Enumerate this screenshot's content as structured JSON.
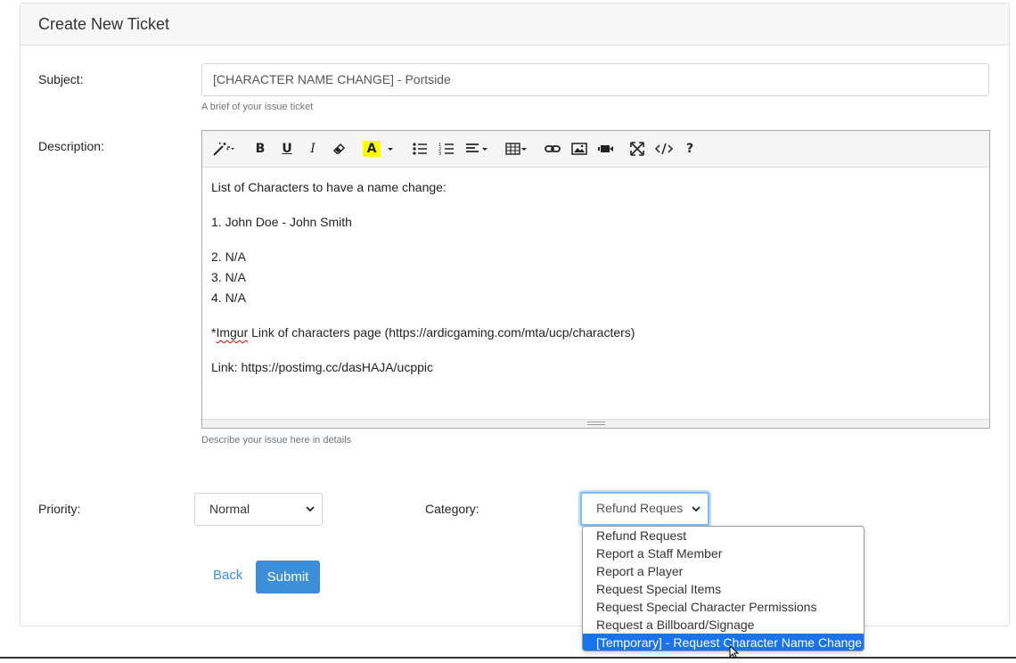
{
  "card": {
    "title": "Create New Ticket"
  },
  "subject": {
    "label": "Subject:",
    "value": "[CHARACTER NAME CHANGE] - Portside",
    "help": "A brief of your issue ticket"
  },
  "description": {
    "label": "Description:",
    "help": "Describe your issue here in details",
    "toolbar_icons": [
      "magic-icon",
      "bold-icon",
      "underline-icon",
      "italic-icon",
      "eraser-icon",
      "font-color-icon",
      "unordered-list-icon",
      "ordered-list-icon",
      "align-icon",
      "table-icon",
      "link-icon",
      "picture-icon",
      "video-icon",
      "fullscreen-icon",
      "code-view-icon",
      "help-icon"
    ],
    "toolbar_text": {
      "bold": "B",
      "underline": "U",
      "italic": "I",
      "color": "A",
      "help": "?"
    },
    "lines": {
      "l1": "List of Characters to have a name change:",
      "l2": "1. John Doe - John Smith",
      "l3": "2. N/A",
      "l4": "3. N/A",
      "l5": "4. N/A",
      "l6_prefix": "*",
      "l6_word": "Imgur",
      "l6_rest": " Link of characters page (https://ardicgaming.com/mta/ucp/characters)",
      "l7": "Link: https://postimg.cc/dasHAJA/ucppic"
    }
  },
  "priority": {
    "label": "Priority:",
    "value": "Normal"
  },
  "category": {
    "label": "Category:",
    "value": "Refund Reques",
    "options": [
      "Refund Request",
      "Report a Staff Member",
      "Report a Player",
      "Request Special Items",
      "Request Special Character Permissions",
      "Request a Billboard/Signage",
      "[Temporary] - Request Character Name Change"
    ],
    "highlighted_index": 6
  },
  "actions": {
    "back": "Back",
    "submit": "Submit"
  },
  "colors": {
    "primary": "#3c8ed8",
    "highlight": "#1a73e8",
    "font_color_yellow": "#ffff00"
  }
}
